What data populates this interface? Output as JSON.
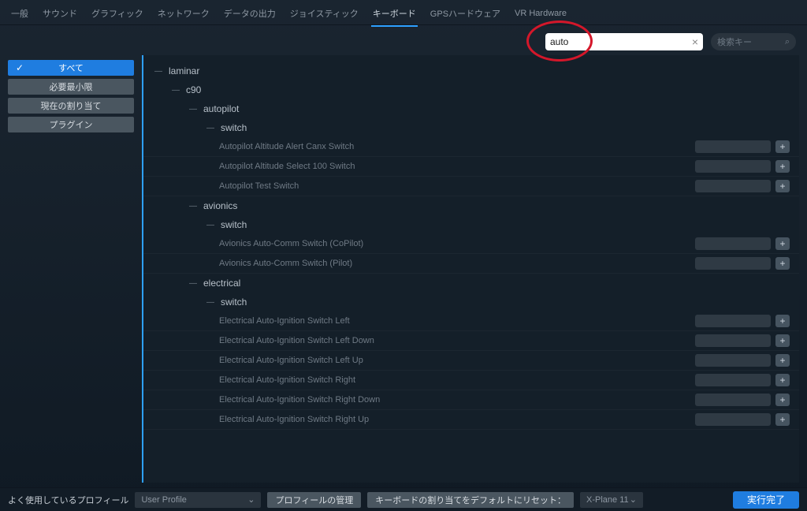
{
  "tabs": [
    "一般",
    "サウンド",
    "グラフィック",
    "ネットワーク",
    "データの出力",
    "ジョイスティック",
    "キーボード",
    "GPSハードウェア",
    "VR Hardware"
  ],
  "active_tab": 6,
  "search": {
    "value": "auto",
    "key_placeholder": "検索キー"
  },
  "sidebar": {
    "items": [
      "すべて",
      "必要最小限",
      "現在の割り当て",
      "プラグイン"
    ],
    "active": 0
  },
  "tree": {
    "root": "laminar",
    "child": "c90",
    "groups": [
      {
        "name": "autopilot",
        "sub": "switch",
        "leaves": [
          "Autopilot Altitude Alert Canx Switch",
          "Autopilot Altitude Select 100 Switch",
          "Autopilot Test Switch"
        ]
      },
      {
        "name": "avionics",
        "sub": "switch",
        "leaves": [
          "Avionics Auto-Comm Switch (CoPilot)",
          "Avionics Auto-Comm Switch (Pilot)"
        ]
      },
      {
        "name": "electrical",
        "sub": "switch",
        "leaves": [
          "Electrical Auto-Ignition Switch Left",
          "Electrical Auto-Ignition Switch Left Down",
          "Electrical Auto-Ignition Switch Left Up",
          "Electrical Auto-Ignition Switch Right",
          "Electrical Auto-Ignition Switch Right Down",
          "Electrical Auto-Ignition Switch Right Up"
        ]
      }
    ]
  },
  "footer": {
    "profile_label": "よく使用しているプロフィール",
    "profile_value": "User Profile",
    "manage": "プロフィールの管理",
    "reset_label": "キーボードの割り当てをデフォルトにリセット：",
    "reset_value": "X-Plane 11",
    "done": "実行完了"
  }
}
